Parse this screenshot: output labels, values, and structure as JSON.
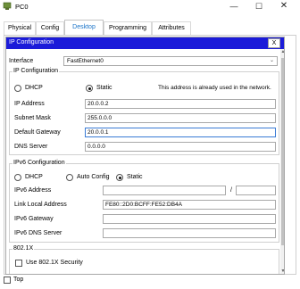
{
  "window": {
    "title": "PC0",
    "min": "—",
    "max": "☐",
    "close": "✕"
  },
  "tabs": [
    {
      "label": "Physical"
    },
    {
      "label": "Config"
    },
    {
      "label": "Desktop"
    },
    {
      "label": "Programming"
    },
    {
      "label": "Attributes"
    }
  ],
  "ip_config": {
    "title": "IP Configuration",
    "close": "X",
    "interface_label": "Interface",
    "interface_value": "FastEthernet0",
    "ipv4": {
      "group_title": "IP Configuration",
      "dhcp_label": "DHCP",
      "static_label": "Static",
      "status_text": "This address is already used in the network.",
      "ip_label": "IP Address",
      "ip_value": "20.0.0.2",
      "mask_label": "Subnet Mask",
      "mask_value": "255.0.0.0",
      "gateway_label": "Default Gateway",
      "gateway_value": "20.0.0.1",
      "dns_label": "DNS Server",
      "dns_value": "0.0.0.0"
    },
    "ipv6": {
      "group_title": "IPv6 Configuration",
      "dhcp_label": "DHCP",
      "auto_label": "Auto Config",
      "static_label": "Static",
      "address_label": "IPv6 Address",
      "address_value": "",
      "prefix_sep": "/",
      "prefix_value": "",
      "link_local_label": "Link Local Address",
      "link_local_value": "FE80::2D0:BCFF:FE52:DB4A",
      "gateway_label": "IPv6 Gateway",
      "gateway_value": "",
      "dns_label": "IPv6 DNS Server",
      "dns_value": ""
    },
    "dot1x": {
      "group_title": "802.1X",
      "use_label": "Use 802.1X Security"
    }
  },
  "footer": {
    "top_label": "Top"
  }
}
